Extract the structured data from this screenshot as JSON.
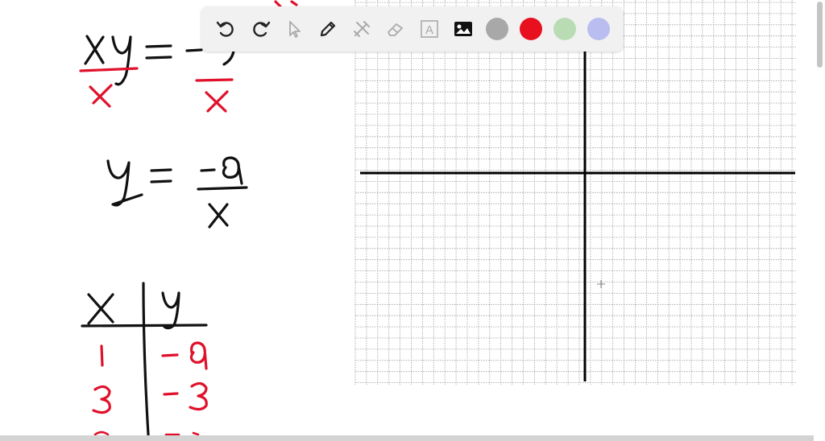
{
  "toolbar": {
    "tools": [
      {
        "name": "undo-icon"
      },
      {
        "name": "redo-icon"
      },
      {
        "name": "select-arrow-icon"
      },
      {
        "name": "pen-icon"
      },
      {
        "name": "tools-icon"
      },
      {
        "name": "eraser-icon"
      },
      {
        "name": "text-icon",
        "glyph": "A"
      },
      {
        "name": "image-icon"
      }
    ],
    "colors": [
      "#a8a8a8",
      "#e8101f",
      "#b9dcb5",
      "#b9bdf0"
    ]
  },
  "notes": {
    "line1_left": "xy",
    "line1_eq": "=",
    "line1_right": "-9",
    "divisor": "x",
    "line2_left": "y",
    "line2_eq": "=",
    "line2_num": "-9",
    "line2_den": "x",
    "table": {
      "headers": [
        "X",
        "y"
      ],
      "rows": [
        [
          "1",
          "-9"
        ],
        [
          "3",
          "-3"
        ]
      ]
    }
  },
  "grid": {
    "line_color": "#9e9e9e",
    "axis_color": "#000000"
  }
}
